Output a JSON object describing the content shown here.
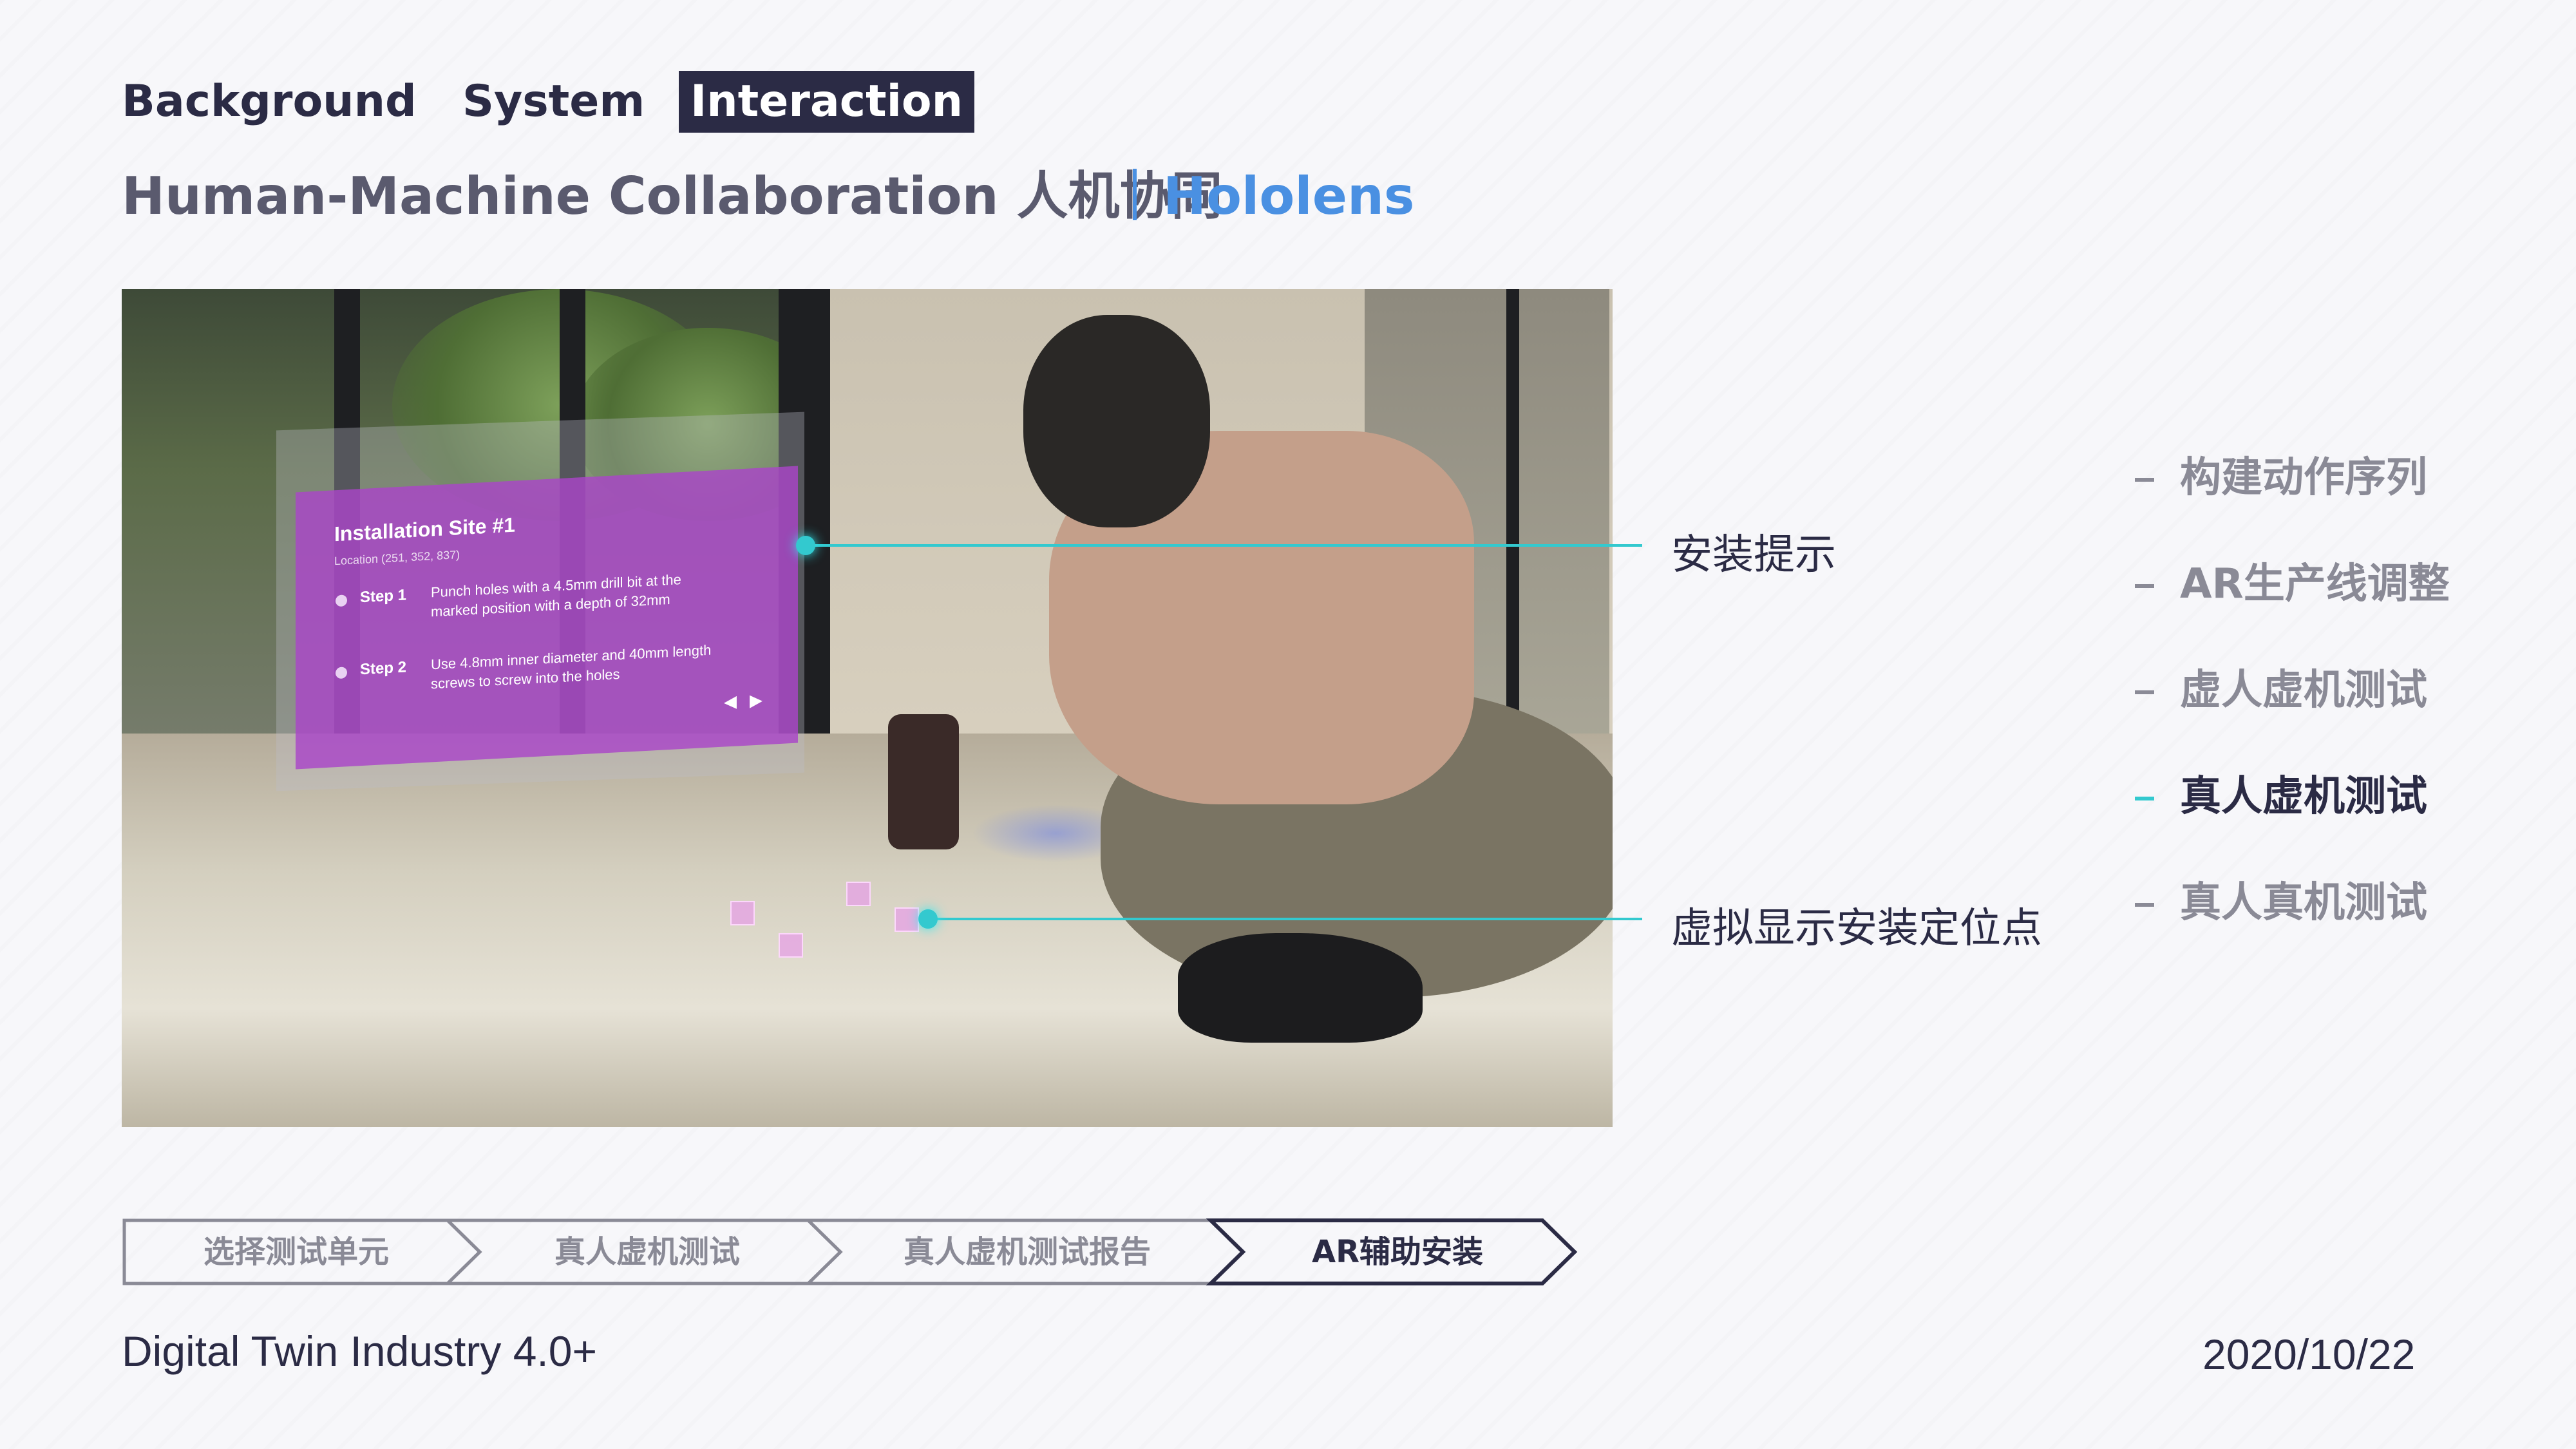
{
  "nav": {
    "tabs": [
      {
        "label": "Background",
        "active": false
      },
      {
        "label": "System",
        "active": false
      },
      {
        "label": "Interaction",
        "active": true
      }
    ]
  },
  "subtitle": {
    "main": "Human-Machine Collaboration 人机协同",
    "highlight": "Hololens"
  },
  "ar_panel": {
    "title": "Installation Site #1",
    "location": "Location (251, 352, 837)",
    "steps": [
      {
        "label": "Step 1",
        "text": "Punch holes with a 4.5mm drill bit at the marked position with a depth of 32mm"
      },
      {
        "label": "Step 2",
        "text": "Use 4.8mm inner diameter and 40mm length screws to screw into the holes"
      }
    ],
    "nav_prev": "◀",
    "nav_next": "▶"
  },
  "callouts": [
    {
      "text": "安装提示"
    },
    {
      "text": "虚拟显示安装定位点"
    }
  ],
  "side_list": {
    "items": [
      {
        "label": "构建动作序列",
        "active": false
      },
      {
        "label": "AR生产线调整",
        "active": false
      },
      {
        "label": "虚人虚机测试",
        "active": false
      },
      {
        "label": "真人虚机测试",
        "active": true
      },
      {
        "label": "真人真机测试",
        "active": false
      }
    ]
  },
  "steps": {
    "items": [
      {
        "label": "选择测试单元",
        "active": false
      },
      {
        "label": "真人虚机测试",
        "active": false
      },
      {
        "label": "真人虚机测试报告",
        "active": false
      },
      {
        "label": "AR辅助安装",
        "active": true
      }
    ]
  },
  "footer": {
    "left": "Digital Twin Industry 4.0+",
    "date": "2020/10/22"
  },
  "colors": {
    "accent": "#33c9cf",
    "highlight": "#4a90e2",
    "dark": "#2b2b45",
    "muted": "#8a8a96",
    "ar_panel": "#aa46c8"
  }
}
